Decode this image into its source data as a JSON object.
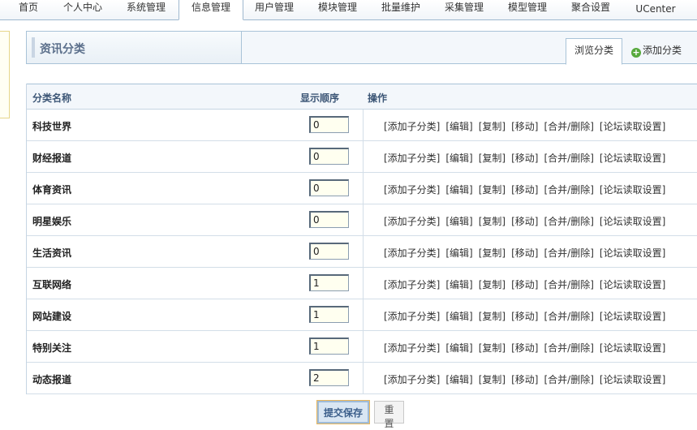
{
  "nav": {
    "tabs": [
      {
        "label": "首页"
      },
      {
        "label": "个人中心"
      },
      {
        "label": "系统管理"
      },
      {
        "label": "信息管理",
        "active": true
      },
      {
        "label": "用户管理"
      },
      {
        "label": "模块管理"
      },
      {
        "label": "批量维护"
      },
      {
        "label": "采集管理"
      },
      {
        "label": "模型管理"
      },
      {
        "label": "聚合设置"
      },
      {
        "label": "UCenter"
      }
    ]
  },
  "header": {
    "title": "资讯分类",
    "browse_tab": "浏览分类",
    "add_tab": "添加分类"
  },
  "table": {
    "columns": {
      "name": "分类名称",
      "order": "显示顺序",
      "ops": "操作"
    },
    "rows": [
      {
        "name": "科技世界",
        "order": "0"
      },
      {
        "name": "财经报道",
        "order": "0"
      },
      {
        "name": "体育资讯",
        "order": "0"
      },
      {
        "name": "明星娱乐",
        "order": "0"
      },
      {
        "name": "生活资讯",
        "order": "0"
      },
      {
        "name": "互联网络",
        "order": "1"
      },
      {
        "name": "网站建设",
        "order": "1"
      },
      {
        "name": "特别关注",
        "order": "1"
      },
      {
        "name": "动态报道",
        "order": "2"
      }
    ],
    "actions": {
      "add_child": "[添加子分类]",
      "edit": "[编辑]",
      "copy": "[复制]",
      "move": "[移动]",
      "merge_delete": "[合并/删除]",
      "forum_settings": "[论坛读取设置]"
    }
  },
  "buttons": {
    "submit": "提交保存",
    "reset": "重置"
  }
}
